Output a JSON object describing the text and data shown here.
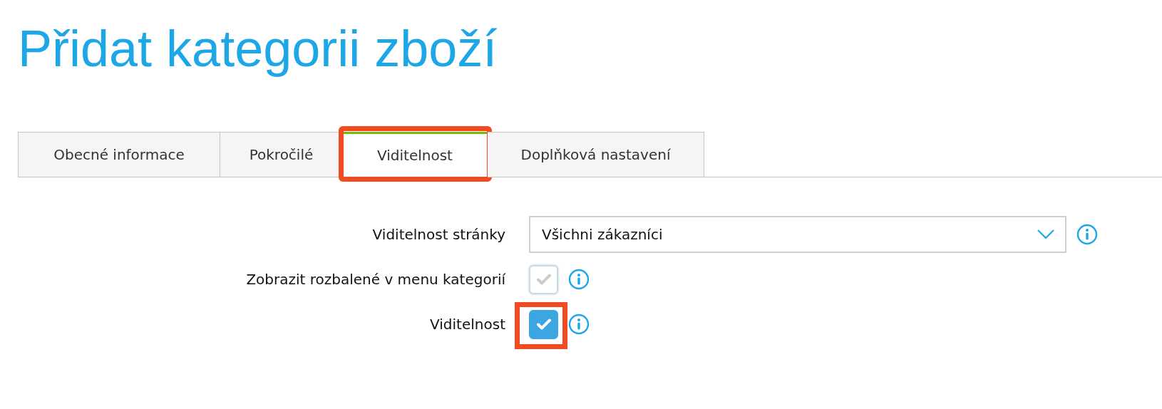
{
  "title": "Přidat kategorii zboží",
  "tabs": [
    {
      "label": "Obecné informace",
      "selected": false,
      "highlighted": false
    },
    {
      "label": "Pokročilé",
      "selected": false,
      "highlighted": false
    },
    {
      "label": "Viditelnost",
      "selected": true,
      "highlighted": true
    },
    {
      "label": "Doplňková nastavení",
      "selected": false,
      "highlighted": false
    }
  ],
  "fields": [
    {
      "kind": "select",
      "label": "Viditelnost stránky",
      "value": "Všichni zákazníci",
      "highlighted": false
    },
    {
      "kind": "checkbox",
      "label": "Zobrazit rozbalené v menu kategorií",
      "checked": false,
      "highlighted": false
    },
    {
      "kind": "checkbox",
      "label": "Viditelnost",
      "checked": true,
      "highlighted": true
    }
  ]
}
